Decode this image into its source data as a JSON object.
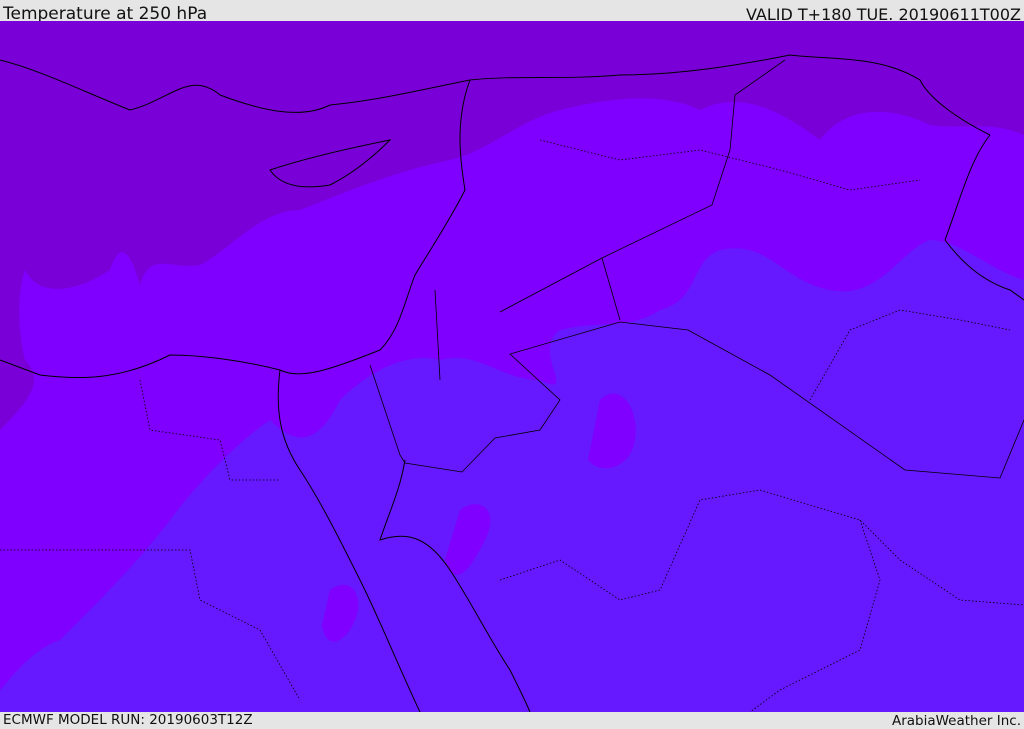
{
  "header": {
    "title": "Temperature at 250 hPa",
    "valid": "VALID T+180 TUE. 20190611T00Z"
  },
  "footer": {
    "model_run": "ECMWF MODEL RUN: 20190603T12Z",
    "credit": "ArabiaWeather Inc."
  },
  "colors": {
    "cold_band": "#7a00d8",
    "mid_band": "#8000ff",
    "warm_band": "#6619ff",
    "border": "#000000"
  }
}
